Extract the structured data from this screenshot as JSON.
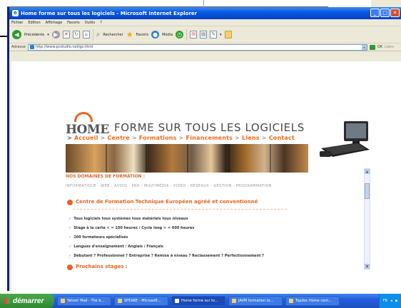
{
  "window": {
    "title": "Home forme sur tous les logiciels - Microsoft Internet Explorer",
    "min_label": "_",
    "max_label": "□",
    "close_label": "✕"
  },
  "menu": [
    "Fichier",
    "Edition",
    "Affichage",
    "Favoris",
    "Outils",
    "?"
  ],
  "toolbar": {
    "back_label": "Précédente",
    "search_label": "Rechercher",
    "favorites_label": "Favoris",
    "media_label": "Média"
  },
  "address": {
    "label": "Adresse",
    "url": "http://www.pcstudio.net/go.html",
    "go_label": "OK",
    "links_label": "Liens"
  },
  "page": {
    "logo_home": "HOME",
    "logo_tagline": "FORME SUR TOUS LES LOGICIELS",
    "nav": [
      "Accueil",
      "Centre",
      "Formations",
      "Financements",
      "Liens",
      "Contact"
    ],
    "nav_separator": ">",
    "domaines_heading": "NOS DOMAINES DE FORMATION :",
    "topics": "INFORMATIQUE - WEB - AUDIO - PAO - MULTIMÉDIA - VIDÉO - RÉSEAUX - GESTION - PROGRAMMATION",
    "centre_title": "Centre de Formation Technique Européen agréé et conventionné",
    "features": [
      "Tous logiciels tous systèmes tous matériels tous niveaux",
      "Stage à la carte < = 100 heures / Cycle long > = 600 heures",
      "200 formateurs spécialisés",
      "Langues d'enseignement : Anglais / Français",
      "Débutant ? Professionnel ? Entreprise ? Remise à niveau ? Reclassement ? Perfectionnement ?"
    ],
    "prochains_label": "Prochains stages :"
  },
  "taskbar": {
    "start_label": "démarrer",
    "tasks": [
      "Yahoo! Mail - The b...",
      "SPEAKE - Microsoft...",
      "Home forme sur to...",
      "JAVM formation to...",
      "Topdoc Home cent..."
    ],
    "tray_lang": "FR"
  },
  "colors": {
    "accent": "#e56524",
    "titlebar": "#0a5ae0",
    "taskbar": "#245edb",
    "start": "#2f8a2f"
  }
}
